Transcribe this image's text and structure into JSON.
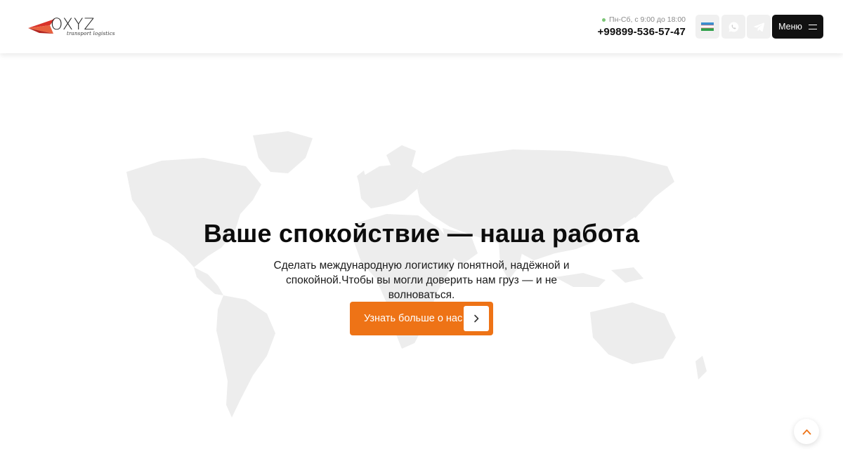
{
  "brand": {
    "name": "OXYZ",
    "tagline": "transport logistics",
    "colors": {
      "accent": "#ee7316",
      "logo_red": "#d9332a",
      "dark": "#111111"
    }
  },
  "header": {
    "hours": "Пн-Сб, с 9:00 до 18:00",
    "phone": "+99899-536-57-47",
    "language": {
      "icon": "uzbekistan-flag-icon"
    },
    "whatsapp": {
      "icon": "whatsapp-icon"
    },
    "telegram": {
      "icon": "telegram-icon"
    },
    "menu_label": "Меню"
  },
  "hero": {
    "title": "Ваше спокойствие — наша работа",
    "subtitle": "Сделать международную логистику понятной, надёжной и спокойной.Чтобы вы могли доверить нам груз — и не волноваться.",
    "cta_label": "Узнать больше о нас",
    "background": "world-map"
  },
  "scroll_top": {
    "icon": "chevron-up-icon"
  }
}
